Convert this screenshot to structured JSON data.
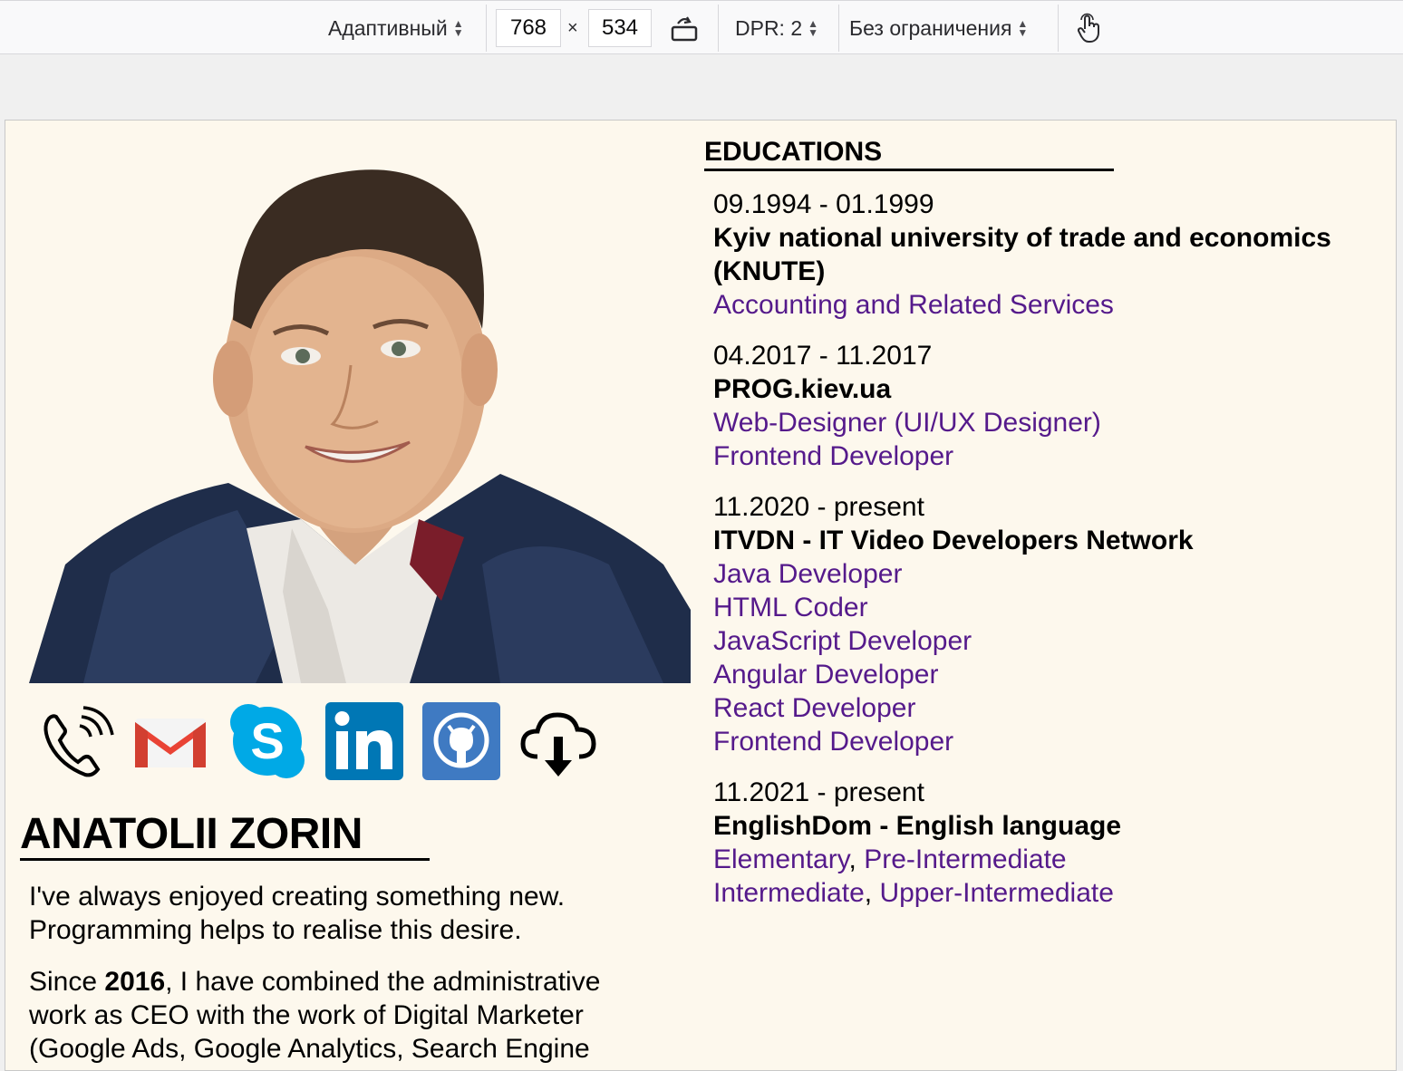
{
  "toolbar": {
    "device": "Адаптивный",
    "width": "768",
    "height": "534",
    "times": "×",
    "dpr": "DPR: 2",
    "throttling": "Без ограничения"
  },
  "profile": {
    "name": "ANATOLII ZORIN",
    "about_p1": "I've always enjoyed creating something new. Programming helps to realise this desire.",
    "about_p2_prefix": "Since ",
    "about_p2_year": "2016",
    "about_p2_rest": ", I have combined the administrative work as CEO with the work of Digital Marketer (Google Ads, Google Analytics, Search Engine"
  },
  "contacts": [
    {
      "name": "phone-icon"
    },
    {
      "name": "gmail-icon"
    },
    {
      "name": "skype-icon"
    },
    {
      "name": "linkedin-icon"
    },
    {
      "name": "github-icon"
    },
    {
      "name": "cloud-download-icon"
    }
  ],
  "education": {
    "title": "EDUCATIONS",
    "items": [
      {
        "date": "09.1994 - 01.1999",
        "school": "Kyiv national university of trade and economics (KNUTE)",
        "courses": [
          "Accounting and Related Services"
        ]
      },
      {
        "date": "04.2017 - 11.2017",
        "school": "PROG.kiev.ua",
        "courses": [
          "Web-Designer (UI/UX Designer)",
          "Frontend Developer"
        ]
      },
      {
        "date": "11.2020 - present",
        "school": "ITVDN - IT Video Developers Network",
        "courses": [
          "Java Developer",
          "HTML Coder",
          "JavaScript Developer",
          "Angular Developer",
          "React Developer",
          "Frontend Developer"
        ]
      },
      {
        "date": "11.2021 - present",
        "school": "EnglishDom - English language",
        "levels_line1": [
          "Elementary",
          "Pre-Intermediate"
        ],
        "levels_line2": [
          "Intermediate",
          "Upper-Intermediate"
        ],
        "separator": ", "
      }
    ]
  }
}
